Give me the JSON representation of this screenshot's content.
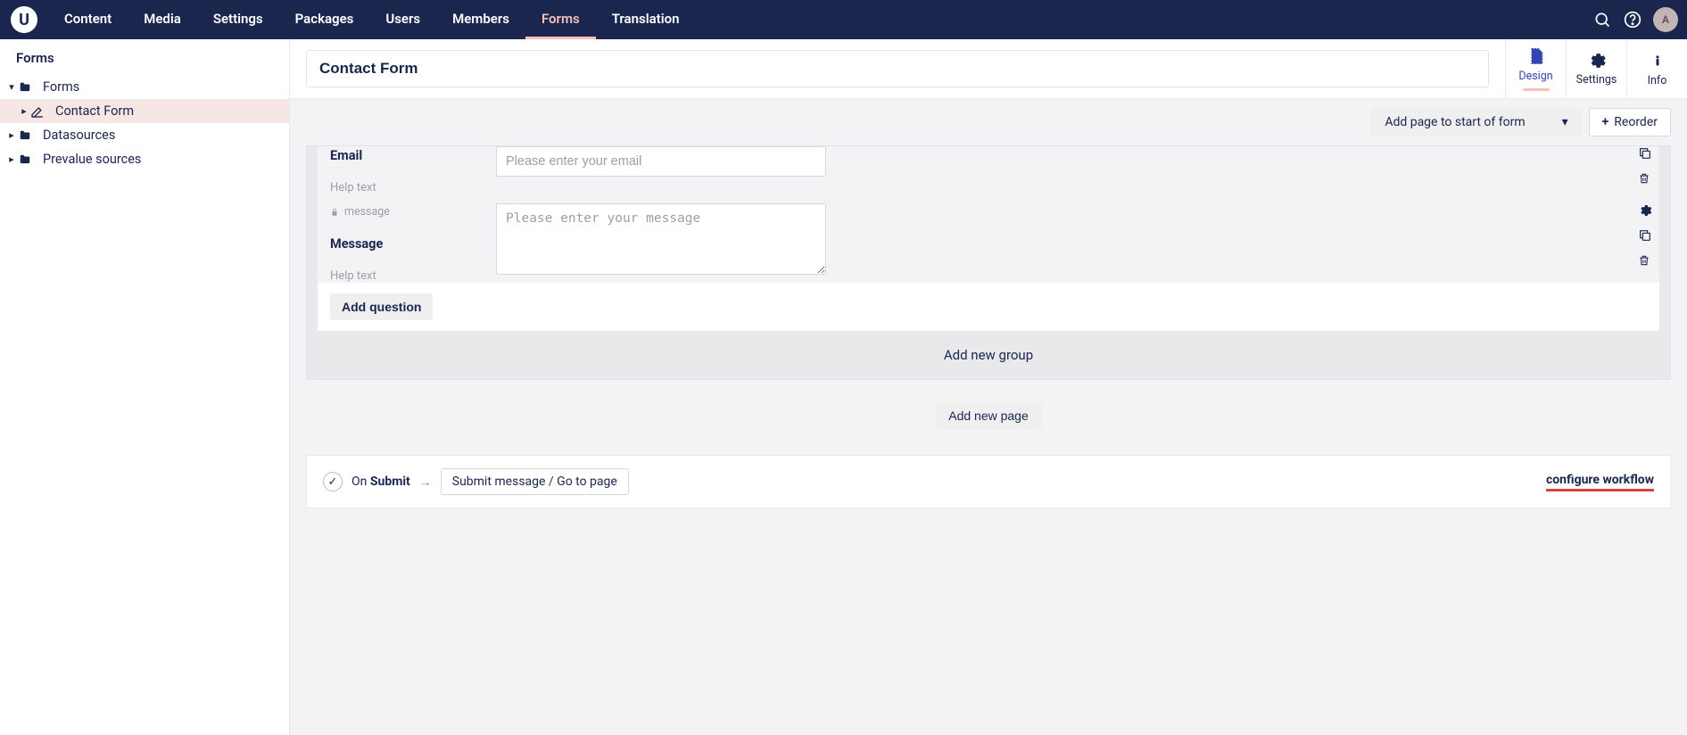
{
  "nav": {
    "tabs": [
      "Content",
      "Media",
      "Settings",
      "Packages",
      "Users",
      "Members",
      "Forms",
      "Translation"
    ],
    "active": 6,
    "avatar_initial": "A"
  },
  "sidebar": {
    "section": "Forms",
    "nodes": [
      {
        "label": "Forms",
        "expanded": true,
        "icon": "folder"
      },
      {
        "label": "Contact Form",
        "icon": "edit",
        "depth": 1,
        "selected": true
      },
      {
        "label": "Datasources",
        "icon": "folder"
      },
      {
        "label": "Prevalue sources",
        "icon": "folder"
      }
    ]
  },
  "editor": {
    "title": "Contact Form",
    "tabs": [
      {
        "label": "Design",
        "icon": "page",
        "active": true
      },
      {
        "label": "Settings",
        "icon": "gear"
      },
      {
        "label": "Info",
        "icon": "info"
      }
    ],
    "toolbar": {
      "add_page_start": "Add page to start of form",
      "reorder": "Reorder"
    },
    "fields": [
      {
        "label": "Email",
        "alias": null,
        "help_text": "Help text",
        "placeholder": "Please enter your email",
        "type": "text",
        "show_gear": false
      },
      {
        "label": "Message",
        "alias": "message",
        "help_text": "Help text",
        "placeholder": "Please enter your message",
        "type": "textarea",
        "show_gear": true
      }
    ],
    "add_question": "Add question",
    "add_group": "Add new group",
    "add_page": "Add new page"
  },
  "workflow": {
    "on_label": "On",
    "submit_label": "Submit",
    "step": "Submit message / Go to page",
    "configure": "configure workflow"
  },
  "icons": {
    "logo": "U"
  }
}
